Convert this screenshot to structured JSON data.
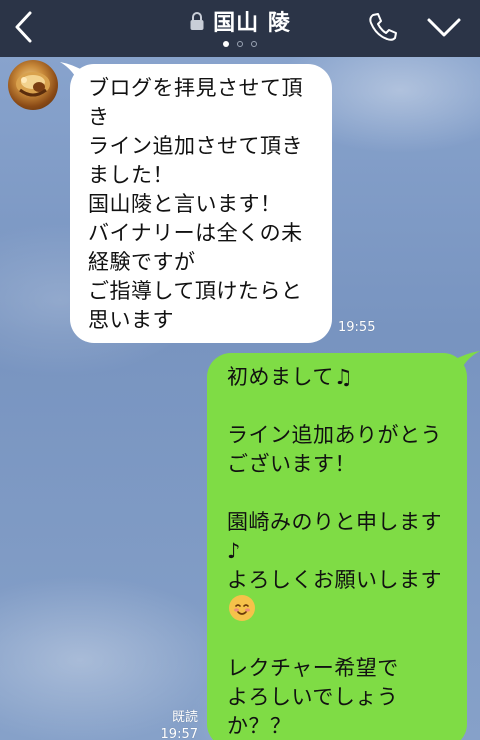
{
  "header": {
    "title": "国山 陵",
    "page_count": 3,
    "active_page": 1,
    "icons": {
      "back": "chevron-left-icon",
      "lock": "lock-icon",
      "call": "phone-icon",
      "menu": "chevron-down-icon"
    }
  },
  "colors": {
    "header_bg": "#2b3447",
    "incoming_bubble": "#ffffff",
    "outgoing_bubble": "#7fdc45",
    "chat_bg": "#7f9cc6"
  },
  "messages": [
    {
      "direction": "incoming",
      "lines": [
        "ブログを拝見させて頂",
        "き",
        "ライン追加させて頂き",
        "ました！",
        "国山陵と言います！",
        "バイナリーは全くの未",
        "経験ですが",
        "ご指導して頂けたらと",
        "思います"
      ],
      "time": "19:55"
    },
    {
      "direction": "outgoing",
      "lines": [
        "初めまして♫",
        "",
        "ライン追加ありがとう",
        "ございます！",
        "",
        "園崎みのりと申します",
        "♪",
        "よろしくお願いします",
        "",
        "",
        "レクチャー希望で",
        "よろしいでしょう",
        "か？？"
      ],
      "emoji_after_line": 7,
      "emoji": "smiling-face-icon",
      "read_label": "既読",
      "time": "19:57"
    }
  ]
}
